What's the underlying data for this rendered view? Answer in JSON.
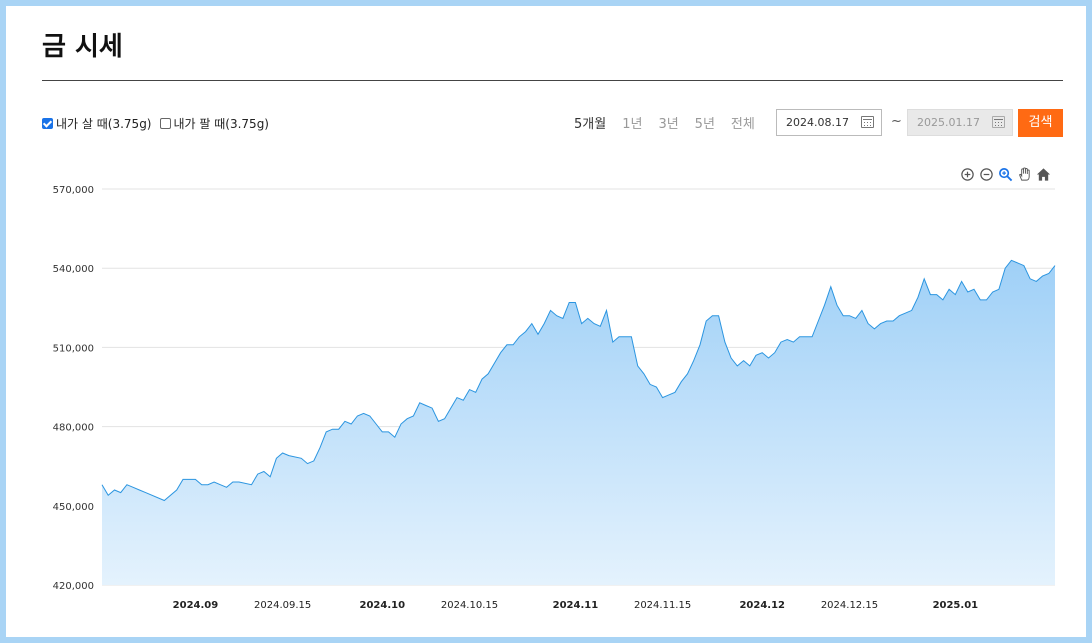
{
  "page": {
    "title": "금 시세"
  },
  "options": {
    "buy_label": "내가 살 때(3.75g)",
    "buy_checked": true,
    "sell_label": "내가 팔 때(3.75g)",
    "sell_checked": false
  },
  "period_tabs": [
    {
      "label": "5개월",
      "active": true
    },
    {
      "label": "1년",
      "active": false
    },
    {
      "label": "3년",
      "active": false
    },
    {
      "label": "5년",
      "active": false
    },
    {
      "label": "전체",
      "active": false
    }
  ],
  "date_range": {
    "start": "2024.08.17",
    "separator": "~",
    "end": "2025.01.17"
  },
  "search_button": "검색",
  "colors": {
    "accent": "#ff6a13",
    "line": "#2b95e0",
    "area_top": "#9fd0f7",
    "area_bottom": "#e4f2fd",
    "frame": "#a9d4f5"
  },
  "toolbox_icons": [
    "zoom-in-icon",
    "zoom-out-icon",
    "zoom-select-icon",
    "pan-hand-icon",
    "home-icon"
  ],
  "chart_data": {
    "type": "area",
    "title": "",
    "xlabel": "",
    "ylabel": "",
    "x_range": [
      "2024-08-17",
      "2025-01-17"
    ],
    "ylim": [
      420000,
      570000
    ],
    "yticks": [
      420000,
      450000,
      480000,
      510000,
      540000,
      570000
    ],
    "ytick_labels": [
      "420,000",
      "450,000",
      "480,000",
      "510,000",
      "540,000",
      "570,000"
    ],
    "xticks": [
      {
        "date": "2024-09-01",
        "label": "2024.09",
        "bold": true
      },
      {
        "date": "2024-09-15",
        "label": "2024.09.15",
        "bold": false
      },
      {
        "date": "2024-10-01",
        "label": "2024.10",
        "bold": true
      },
      {
        "date": "2024-10-15",
        "label": "2024.10.15",
        "bold": false
      },
      {
        "date": "2024-11-01",
        "label": "2024.11",
        "bold": true
      },
      {
        "date": "2024-11-15",
        "label": "2024.11.15",
        "bold": false
      },
      {
        "date": "2024-12-01",
        "label": "2024.12",
        "bold": true
      },
      {
        "date": "2024-12-15",
        "label": "2024.12.15",
        "bold": false
      },
      {
        "date": "2025-01-01",
        "label": "2025.01",
        "bold": true
      }
    ],
    "grid": true,
    "legend": "none",
    "series": [
      {
        "points": [
          [
            "2024-08-17",
            458000
          ],
          [
            "2024-08-18",
            454000
          ],
          [
            "2024-08-19",
            456000
          ],
          [
            "2024-08-20",
            455000
          ],
          [
            "2024-08-21",
            458000
          ],
          [
            "2024-08-22",
            457000
          ],
          [
            "2024-08-23",
            456000
          ],
          [
            "2024-08-24",
            455000
          ],
          [
            "2024-08-27",
            452000
          ],
          [
            "2024-08-29",
            456000
          ],
          [
            "2024-08-30",
            460000
          ],
          [
            "2024-08-31",
            460000
          ],
          [
            "2024-09-01",
            460000
          ],
          [
            "2024-09-02",
            458000
          ],
          [
            "2024-09-03",
            458000
          ],
          [
            "2024-09-04",
            459000
          ],
          [
            "2024-09-05",
            458000
          ],
          [
            "2024-09-06",
            457000
          ],
          [
            "2024-09-07",
            459000
          ],
          [
            "2024-09-08",
            459000
          ],
          [
            "2024-09-10",
            458000
          ],
          [
            "2024-09-11",
            462000
          ],
          [
            "2024-09-12",
            463000
          ],
          [
            "2024-09-13",
            461000
          ],
          [
            "2024-09-14",
            468000
          ],
          [
            "2024-09-15",
            470000
          ],
          [
            "2024-09-16",
            469000
          ],
          [
            "2024-09-18",
            468000
          ],
          [
            "2024-09-19",
            466000
          ],
          [
            "2024-09-20",
            467000
          ],
          [
            "2024-09-21",
            472000
          ],
          [
            "2024-09-22",
            478000
          ],
          [
            "2024-09-23",
            479000
          ],
          [
            "2024-09-24",
            479000
          ],
          [
            "2024-09-25",
            482000
          ],
          [
            "2024-09-26",
            481000
          ],
          [
            "2024-09-27",
            484000
          ],
          [
            "2024-09-28",
            485000
          ],
          [
            "2024-09-29",
            484000
          ],
          [
            "2024-09-30",
            481000
          ],
          [
            "2024-10-01",
            478000
          ],
          [
            "2024-10-02",
            478000
          ],
          [
            "2024-10-03",
            476000
          ],
          [
            "2024-10-04",
            481000
          ],
          [
            "2024-10-05",
            483000
          ],
          [
            "2024-10-06",
            484000
          ],
          [
            "2024-10-07",
            489000
          ],
          [
            "2024-10-08",
            488000
          ],
          [
            "2024-10-09",
            487000
          ],
          [
            "2024-10-10",
            482000
          ],
          [
            "2024-10-11",
            483000
          ],
          [
            "2024-10-12",
            487000
          ],
          [
            "2024-10-13",
            491000
          ],
          [
            "2024-10-14",
            490000
          ],
          [
            "2024-10-15",
            494000
          ],
          [
            "2024-10-16",
            493000
          ],
          [
            "2024-10-17",
            498000
          ],
          [
            "2024-10-18",
            500000
          ],
          [
            "2024-10-19",
            504000
          ],
          [
            "2024-10-20",
            508000
          ],
          [
            "2024-10-21",
            511000
          ],
          [
            "2024-10-22",
            511000
          ],
          [
            "2024-10-23",
            514000
          ],
          [
            "2024-10-24",
            516000
          ],
          [
            "2024-10-25",
            519000
          ],
          [
            "2024-10-26",
            515000
          ],
          [
            "2024-10-27",
            519000
          ],
          [
            "2024-10-28",
            524000
          ],
          [
            "2024-10-29",
            522000
          ],
          [
            "2024-10-30",
            521000
          ],
          [
            "2024-10-31",
            527000
          ],
          [
            "2024-11-01",
            527000
          ],
          [
            "2024-11-02",
            519000
          ],
          [
            "2024-11-03",
            521000
          ],
          [
            "2024-11-04",
            519000
          ],
          [
            "2024-11-05",
            518000
          ],
          [
            "2024-11-06",
            524000
          ],
          [
            "2024-11-07",
            512000
          ],
          [
            "2024-11-08",
            514000
          ],
          [
            "2024-11-09",
            514000
          ],
          [
            "2024-11-10",
            514000
          ],
          [
            "2024-11-11",
            503000
          ],
          [
            "2024-11-12",
            500000
          ],
          [
            "2024-11-13",
            496000
          ],
          [
            "2024-11-14",
            495000
          ],
          [
            "2024-11-15",
            491000
          ],
          [
            "2024-11-16",
            492000
          ],
          [
            "2024-11-17",
            493000
          ],
          [
            "2024-11-18",
            497000
          ],
          [
            "2024-11-19",
            500000
          ],
          [
            "2024-11-20",
            505000
          ],
          [
            "2024-11-21",
            511000
          ],
          [
            "2024-11-22",
            520000
          ],
          [
            "2024-11-23",
            522000
          ],
          [
            "2024-11-24",
            522000
          ],
          [
            "2024-11-25",
            512000
          ],
          [
            "2024-11-26",
            506000
          ],
          [
            "2024-11-27",
            503000
          ],
          [
            "2024-11-28",
            505000
          ],
          [
            "2024-11-29",
            503000
          ],
          [
            "2024-11-30",
            507000
          ],
          [
            "2024-12-01",
            508000
          ],
          [
            "2024-12-02",
            506000
          ],
          [
            "2024-12-03",
            508000
          ],
          [
            "2024-12-04",
            512000
          ],
          [
            "2024-12-05",
            513000
          ],
          [
            "2024-12-06",
            512000
          ],
          [
            "2024-12-07",
            514000
          ],
          [
            "2024-12-08",
            514000
          ],
          [
            "2024-12-09",
            514000
          ],
          [
            "2024-12-10",
            520000
          ],
          [
            "2024-12-11",
            526000
          ],
          [
            "2024-12-12",
            533000
          ],
          [
            "2024-12-13",
            526000
          ],
          [
            "2024-12-14",
            522000
          ],
          [
            "2024-12-15",
            522000
          ],
          [
            "2024-12-16",
            521000
          ],
          [
            "2024-12-17",
            524000
          ],
          [
            "2024-12-18",
            519000
          ],
          [
            "2024-12-19",
            517000
          ],
          [
            "2024-12-20",
            519000
          ],
          [
            "2024-12-21",
            520000
          ],
          [
            "2024-12-22",
            520000
          ],
          [
            "2024-12-23",
            522000
          ],
          [
            "2024-12-24",
            523000
          ],
          [
            "2024-12-25",
            524000
          ],
          [
            "2024-12-26",
            529000
          ],
          [
            "2024-12-27",
            536000
          ],
          [
            "2024-12-28",
            530000
          ],
          [
            "2024-12-29",
            530000
          ],
          [
            "2024-12-30",
            528000
          ],
          [
            "2024-12-31",
            532000
          ],
          [
            "2025-01-01",
            530000
          ],
          [
            "2025-01-02",
            535000
          ],
          [
            "2025-01-03",
            531000
          ],
          [
            "2025-01-04",
            532000
          ],
          [
            "2025-01-05",
            528000
          ],
          [
            "2025-01-06",
            528000
          ],
          [
            "2025-01-07",
            531000
          ],
          [
            "2025-01-08",
            532000
          ],
          [
            "2025-01-09",
            540000
          ],
          [
            "2025-01-10",
            543000
          ],
          [
            "2025-01-11",
            542000
          ],
          [
            "2025-01-12",
            541000
          ],
          [
            "2025-01-13",
            536000
          ],
          [
            "2025-01-14",
            535000
          ],
          [
            "2025-01-15",
            537000
          ],
          [
            "2025-01-16",
            538000
          ],
          [
            "2025-01-17",
            541000
          ]
        ]
      }
    ]
  }
}
